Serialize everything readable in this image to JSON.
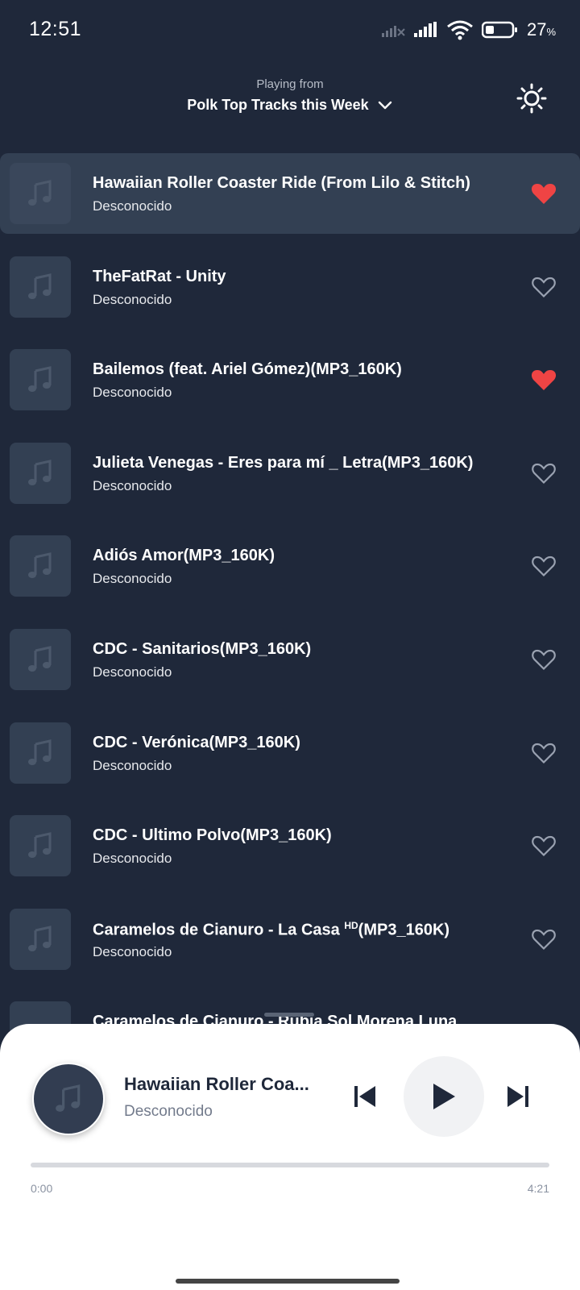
{
  "status_bar": {
    "time": "12:51",
    "battery_percent": "27",
    "battery_symbol": "%"
  },
  "header": {
    "caption": "Playing from",
    "playlist_name": "Polk Top Tracks this Week",
    "dropdown_icon": "chevron-down-icon",
    "theme_icon": "sun-icon"
  },
  "tracks": [
    {
      "title": "Hawaiian Roller Coaster Ride (From Lilo & Stitch)",
      "artist": "Desconocido",
      "liked": true,
      "active": true
    },
    {
      "title": "TheFatRat - Unity",
      "artist": "Desconocido",
      "liked": false,
      "active": false
    },
    {
      "title": "Bailemos (feat. Ariel Gómez)(MP3_160K)",
      "artist": "Desconocido",
      "liked": true,
      "active": false
    },
    {
      "title": "Julieta Venegas - Eres para mí _ Letra(MP3_160K)",
      "artist": "Desconocido",
      "liked": false,
      "active": false
    },
    {
      "title": "Adiós Amor(MP3_160K)",
      "artist": "Desconocido",
      "liked": false,
      "active": false
    },
    {
      "title": "CDC - Sanitarios(MP3_160K)",
      "artist": "Desconocido",
      "liked": false,
      "active": false
    },
    {
      "title": "CDC - Verónica(MP3_160K)",
      "artist": "Desconocido",
      "liked": false,
      "active": false
    },
    {
      "title": "CDC - Ultimo Polvo(MP3_160K)",
      "artist": "Desconocido",
      "liked": false,
      "active": false
    },
    {
      "title_prefix": "Caramelos de Cianuro - La Casa ",
      "title_sup": "HD",
      "title_suffix": "(MP3_160K)",
      "artist": "Desconocido",
      "liked": false,
      "active": false
    },
    {
      "title": "Caramelos de Cianuro - Rubia Sol Morena Luna",
      "artist": "",
      "liked": false,
      "active": false
    }
  ],
  "player": {
    "title": "Hawaiian Roller Coa...",
    "artist": "Desconocido",
    "elapsed": "0:00",
    "total": "4:21",
    "progress": 0
  },
  "colors": {
    "background": "#1f283a",
    "row_active": "#334053",
    "heart_liked": "#ef4444",
    "heart_outline": "#9aa2b1"
  },
  "icons": {
    "track_art": "music-note-icon",
    "like": "heart-icon",
    "prev": "skip-previous-icon",
    "play": "play-icon",
    "next": "skip-next-icon"
  }
}
